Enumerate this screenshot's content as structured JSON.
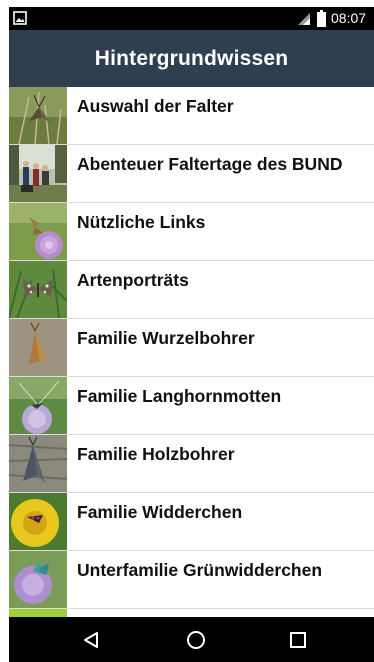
{
  "status_bar": {
    "time": "08:07",
    "icons": [
      "image-notification-icon",
      "signal-icon",
      "battery-icon"
    ]
  },
  "toolbar": {
    "title": "Hintergrundwissen"
  },
  "list": {
    "items": [
      {
        "label": "Auswahl der Falter",
        "thumbnail": "moth-on-grass-thumbnail"
      },
      {
        "label": "Abenteuer Faltertage des BUND",
        "thumbnail": "people-in-park-thumbnail"
      },
      {
        "label": "Nützliche Links",
        "thumbnail": "butterfly-on-purple-flower-thumbnail"
      },
      {
        "label": "Artenporträts",
        "thumbnail": "skipper-butterfly-thumbnail"
      },
      {
        "label": "Familie Wurzelbohrer",
        "thumbnail": "brown-moth-thumbnail"
      },
      {
        "label": "Familie Langhornmotten",
        "thumbnail": "longhorn-moth-on-flower-thumbnail"
      },
      {
        "label": "Familie Holzbohrer",
        "thumbnail": "grey-moth-on-bark-thumbnail"
      },
      {
        "label": "Familie Widderchen",
        "thumbnail": "burnet-on-yellow-flower-thumbnail"
      },
      {
        "label": "Unterfamilie Grünwidderchen",
        "thumbnail": "forester-on-purple-flower-thumbnail"
      }
    ]
  },
  "nav_bar": {
    "buttons": [
      "back-icon",
      "home-icon",
      "recents-icon"
    ]
  },
  "colors": {
    "toolbar_bg": "#2f3f4f",
    "status_bar_bg": "#000000",
    "nav_bar_bg": "#000000",
    "list_text": "#111111",
    "divider": "#dcdcdc"
  }
}
